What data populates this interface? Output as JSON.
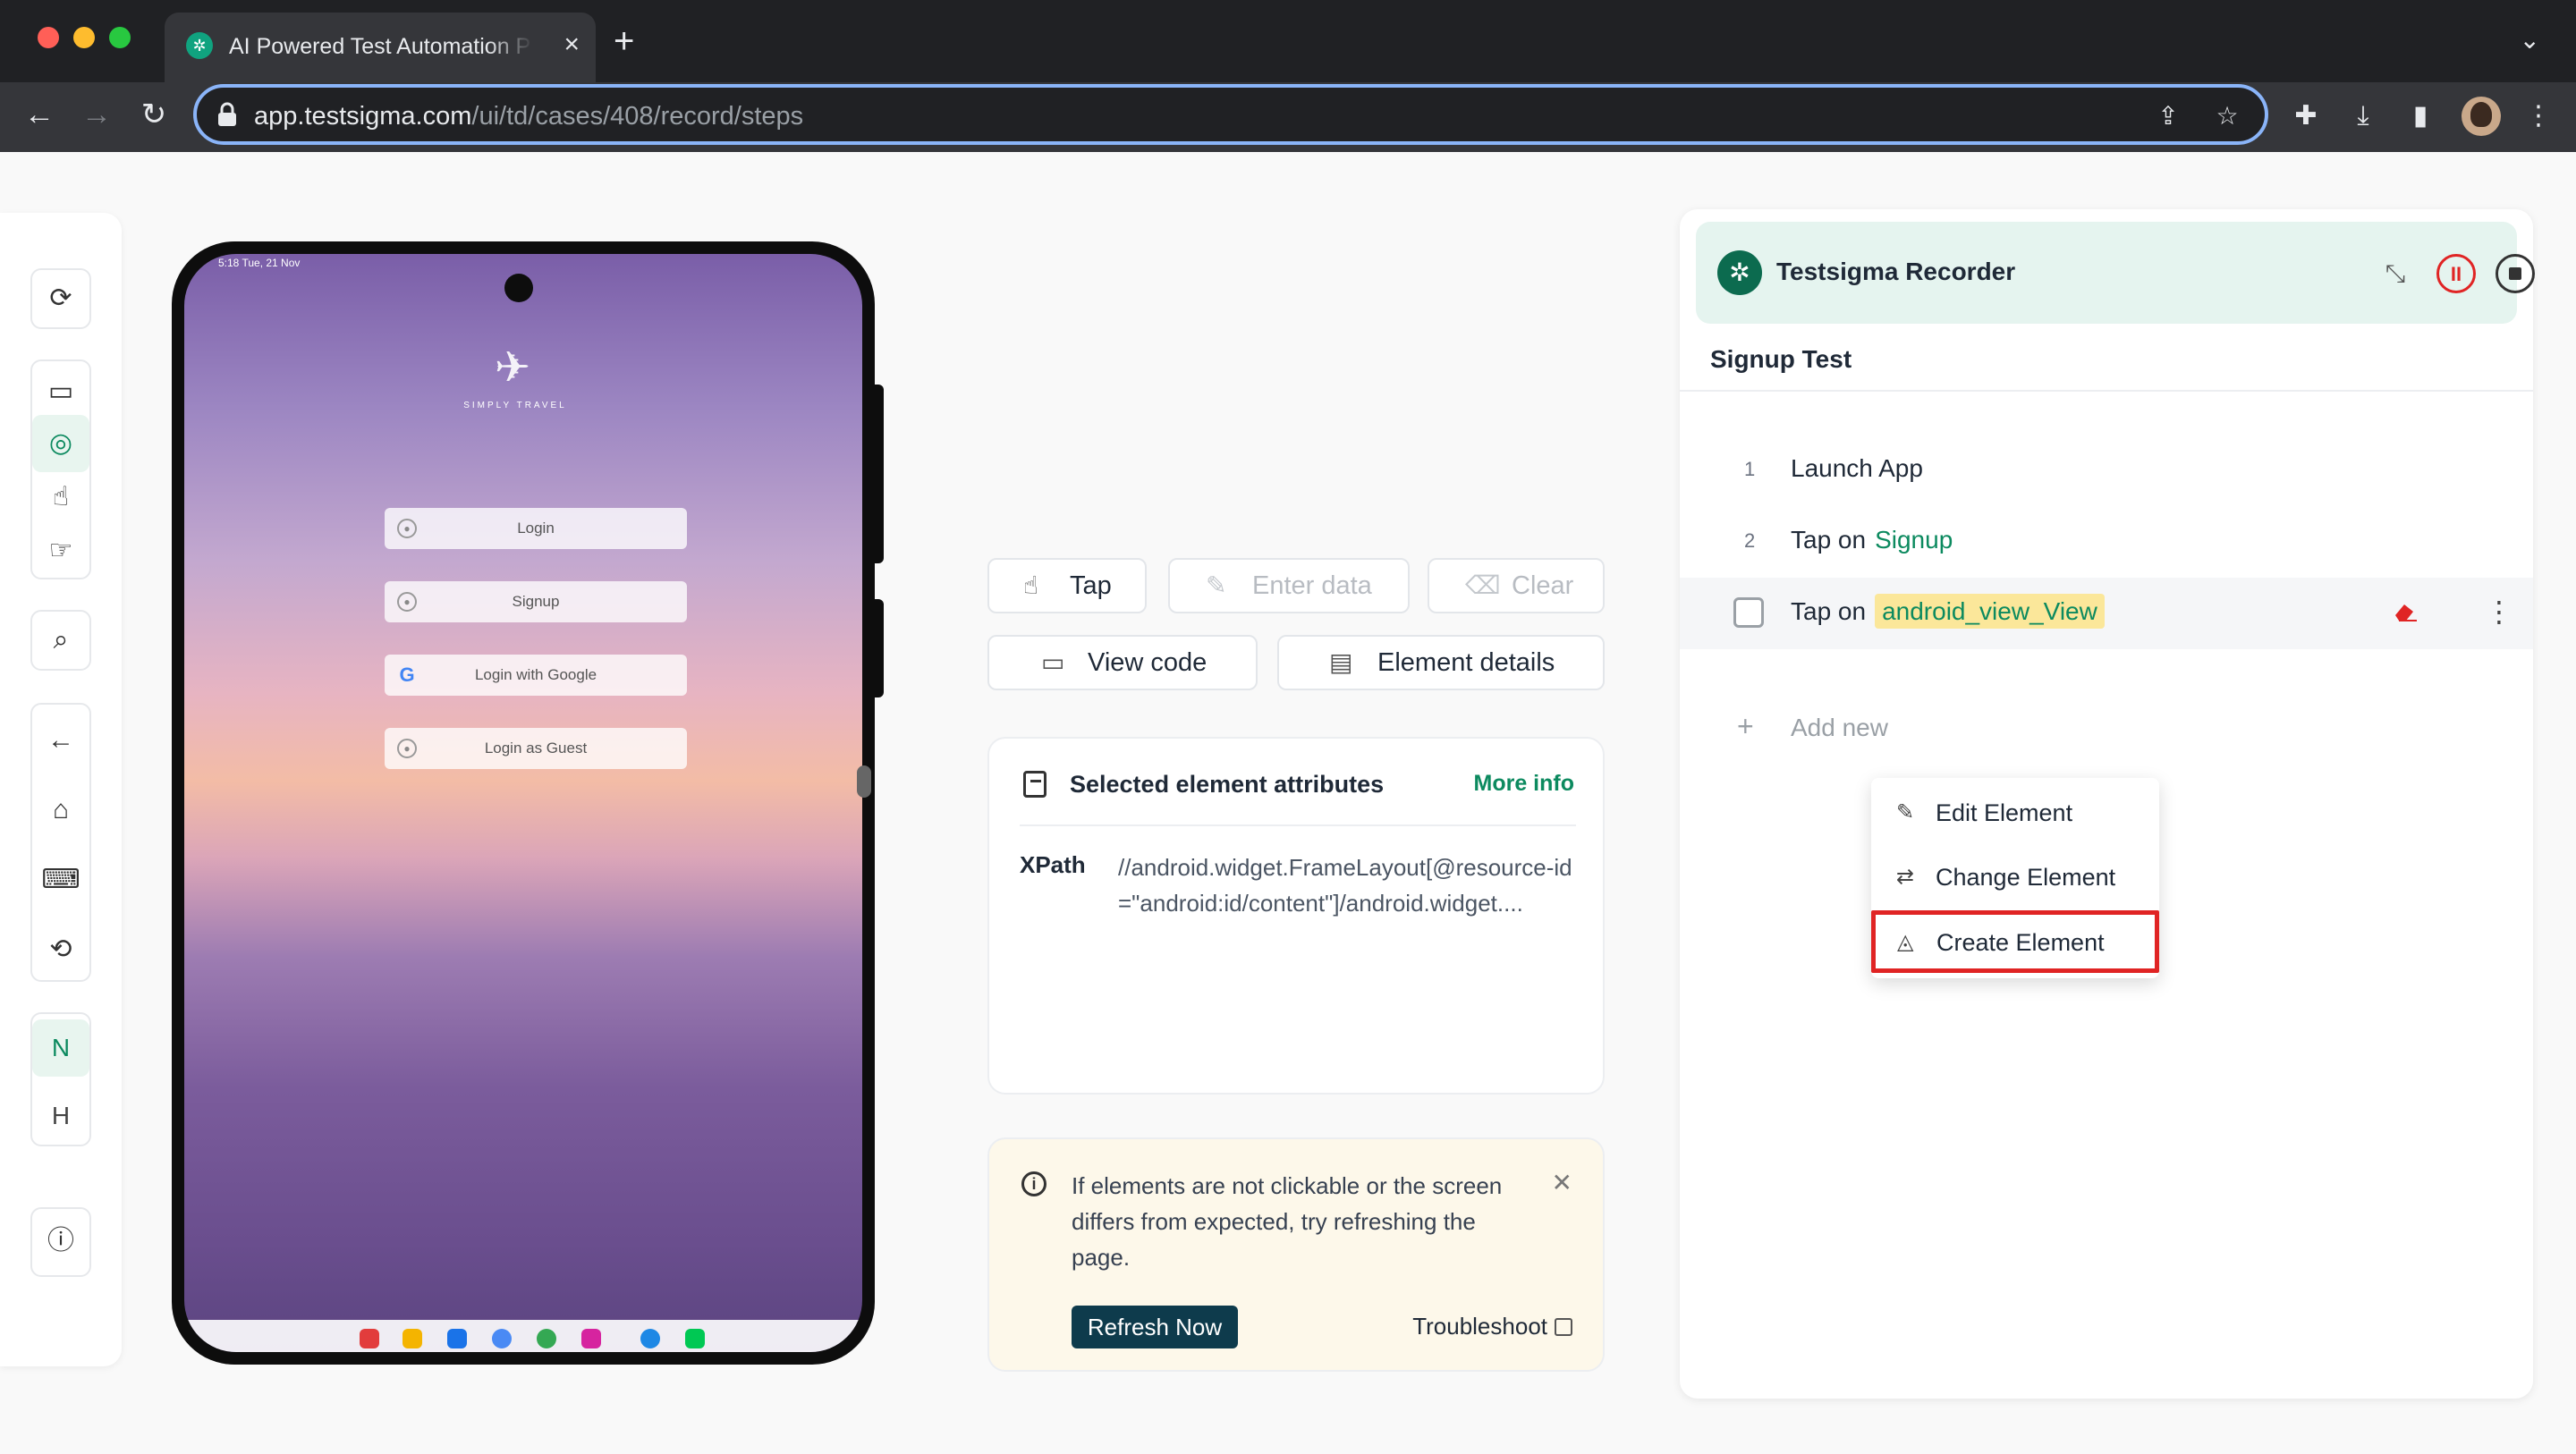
{
  "browser": {
    "tab_title": "AI Powered Test Automation P",
    "url_domain": "app.testsigma.com",
    "url_path": "/ui/td/cases/408/record/steps"
  },
  "device": {
    "status_time": "5:18  Tue, 21 Nov",
    "app_name": "SIMPLY TRAVEL",
    "buttons": [
      "Login",
      "Signup",
      "Login with Google",
      "Login as Guest"
    ]
  },
  "actions": {
    "tap": "Tap",
    "enter_data": "Enter data",
    "clear": "Clear",
    "view_code": "View code",
    "element_details": "Element details"
  },
  "attributes": {
    "title": "Selected element attributes",
    "more_info": "More info",
    "xpath_label": "XPath",
    "xpath_value": "//android.widget.FrameLayout[@resource-id=\"android:id/content\"]/android.widget...."
  },
  "info": {
    "message": "If elements are not clickable or the screen differs from expected, try refreshing the page.",
    "refresh": "Refresh Now",
    "troubleshoot": "Troubleshoot"
  },
  "recorder": {
    "title": "Testsigma Recorder",
    "test_name": "Signup Test",
    "steps": [
      {
        "num": "1",
        "text": "Launch App",
        "element": ""
      },
      {
        "num": "2",
        "text": "Tap on",
        "element": "Signup"
      },
      {
        "num": "",
        "text": "Tap on",
        "element": "android_view_View"
      }
    ],
    "add_new": "Add new"
  },
  "context_menu": {
    "items": [
      "Edit Element",
      "Change Element",
      "Create Element"
    ]
  },
  "left_toolbar": {
    "letters": [
      "N",
      "H"
    ]
  },
  "colors": {
    "accent": "#0c8a5f",
    "highlight_border": "#e02424",
    "element_highlight": "#fbe79a"
  }
}
